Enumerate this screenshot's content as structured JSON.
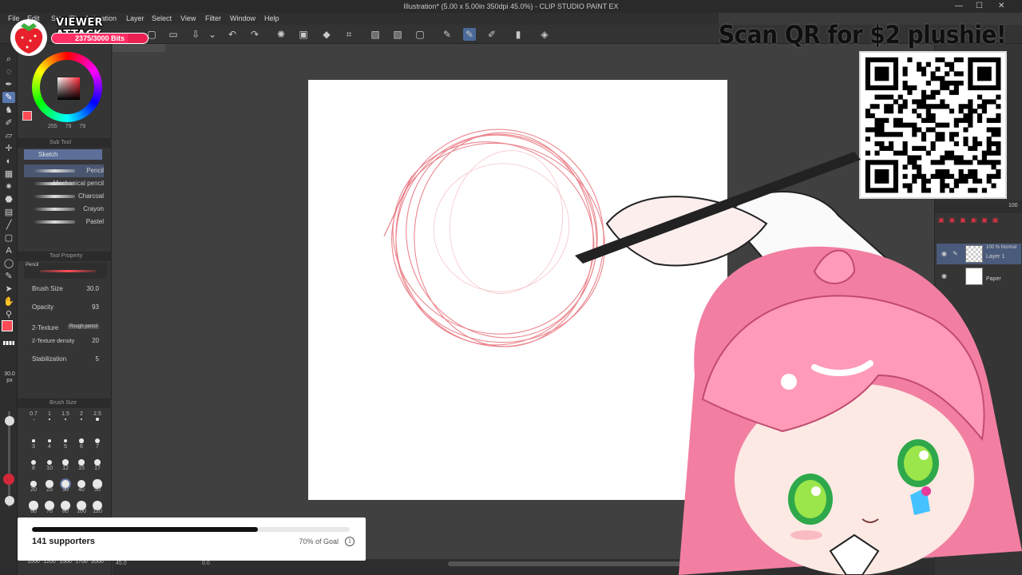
{
  "window": {
    "title": "Illustration* (5.00 x 5.00in 350dpi 45.0%) - CLIP STUDIO PAINT EX",
    "minimize": "—",
    "maximize": "☐",
    "close": "✕"
  },
  "menu": [
    "File",
    "Edit",
    "Story(P)",
    "Animation",
    "Layer",
    "Select",
    "View",
    "Filter",
    "Window",
    "Help"
  ],
  "color": {
    "values": [
      "255",
      "79",
      "79"
    ],
    "main_color": "#ff4b55",
    "accent": "#5b6f99"
  },
  "subtool": {
    "header": "Sub Tool",
    "tab": "Sketch",
    "brushes": [
      "Pencil",
      "Mechanical pencil",
      "Charcoal",
      "Crayon",
      "Pastel"
    ],
    "selected": "Pencil"
  },
  "tool_property": {
    "header": "Tool Property",
    "preview_label": "Pencil",
    "rows": [
      {
        "label": "Brush Size",
        "value": "30.0"
      },
      {
        "label": "Opacity",
        "value": "93"
      },
      {
        "label": "2-Texture",
        "value": "Rough pencil"
      },
      {
        "label": "2-Texture density",
        "value": "20"
      },
      {
        "label": "Stabilization",
        "value": "5"
      }
    ]
  },
  "size_readout": "30.0 px",
  "brush_size": {
    "header": "Brush Size",
    "rows": [
      [
        "0.7",
        "1",
        "1.5",
        "2",
        "2.5"
      ],
      [
        "3",
        "4",
        "5",
        "6",
        "7"
      ],
      [
        "8",
        "10",
        "12",
        "15",
        "17"
      ],
      [
        "20",
        "25",
        "30",
        "40",
        "50"
      ],
      [
        "60",
        "70",
        "80",
        "100",
        "120"
      ]
    ],
    "bottom_row": [
      "1000",
      "1200",
      "1500",
      "1700",
      "2000"
    ],
    "selected": "30"
  },
  "layers": {
    "opacity_value": "100",
    "items": [
      {
        "name": "Layer 1",
        "info": "100 % Normal",
        "selected": true
      },
      {
        "name": "Paper",
        "info": "",
        "selected": false
      }
    ]
  },
  "status": {
    "zoom": "45.0",
    "angle": "0.0"
  },
  "overlay": {
    "viewer_attack": {
      "title": "VIEWER ATTACK",
      "bits": "2375/3000 Bits",
      "progress": 0.79
    },
    "qr": {
      "title": "Scan QR for $2 plushie!"
    },
    "supporters": {
      "count_text": "141 supporters",
      "goal_text": "70% of Goal",
      "progress": 0.71
    }
  }
}
